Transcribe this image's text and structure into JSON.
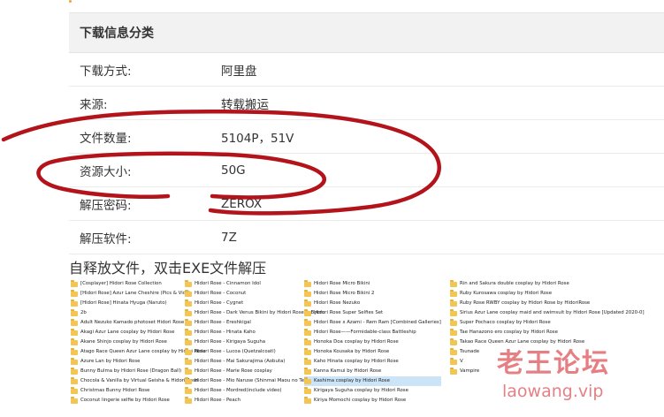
{
  "info": {
    "header": "下载信息分类",
    "rows": [
      {
        "key": "下载方式:",
        "value": "阿里盘"
      },
      {
        "key": "来源:",
        "value": "转载搬运"
      },
      {
        "key": "文件数量:",
        "value": "5104P，51V"
      },
      {
        "key": "资源大小:",
        "value": "50G"
      },
      {
        "key": "解压密码:",
        "value": "ZEROX"
      },
      {
        "key": "解压软件:",
        "value": "7Z"
      }
    ]
  },
  "sfx_note": "自释放文件，双击EXE文件解压",
  "files": {
    "col1": [
      "[Cosplayer] Hidori Rose Collection",
      "[Hidori Rose] Azur Lane Cheshire (Pics & Vids)",
      "[Hidori Rose] Hinata Hyuga (Naruto)",
      "2b",
      "Adult Nezuko Kamado photoset Hidori Rose",
      "Akagi Azur Lane cosplay by Hidori Rose",
      "Akane Shinjo cosplay by Hidori Rose",
      "Atago Race Queen Azur Lane cosplay by Hidori Rose",
      "Azure Lan by Hidori Rose",
      "Bunny Bulma by Hidori Rose (Dragon Ball)",
      "Chocola & Vanilla by Virtual Geisha & Hidori Rose",
      "Christmas Bunny Hidori Rose",
      "Coconut lingerie selfie by Hidori Rose"
    ],
    "col2": [
      "Hidori Rose - Cinnamon Idol",
      "Hidori Rose - Coconut",
      "Hidori Rose - Cygnet",
      "Hidori Rose - Dark Venus Bikini by Hidori Rose & Byoru",
      "Hidori Rose - Ereshkigal",
      "Hidori Rose - Hinata Kaho",
      "Hidori Rose - Kirigaya Suguha",
      "Hidori Rose - Lucoa (Quetzalcoatl)",
      "Hidori Rose - Mai Sakurajima (Aobuta)",
      "Hidori Rose - Marie Rose cosplay",
      "Hidori Rose - Mio Naruse (Shinmai Maou no Testament)",
      "Hidori Rose - Mordred(include video)",
      "Hidori Rose - Peach"
    ],
    "col3": [
      "Hidori Rose Micro Bikini",
      "Hidori Rose Micro Bikini 2",
      "Hidori Rose Nezuko",
      "Hidori Rose Super Selfies Set",
      "Hidori Rose x Azami - Rem Ram [Combined Galleries]",
      "Hidori Rose——Formidable-class Battleship",
      "Honoka Doa cosplay by Hidori Rose",
      "Honoka Kousaka by Hidori Rose",
      "Kaho Hinata cosplay by Hidori Rose",
      "Kanna Kamui by Hidori Rose",
      "Kashima cosplay by Hidori Rose",
      "Kirigaya Suguha cosplay by Hidori Rose",
      "Kiriya Momochi cosplay by Hidori Rose"
    ],
    "col4": [
      "Rin and Sakura double cosplay by Hidori Rose",
      "Ruby Kurosawa cosplay by Hidori Rose",
      "Ruby Rose RWBY cosplay by Hidori Rose by HidoriRose",
      "Sirius Azur Lane cosplay maid and swimsuit by Hidori Rose [Updated 2020-0]",
      "Super Pochaco cosplay by Hidori Rose",
      "Tae Hanazono ero cosplay by Hidori Rose",
      "Takao Race Queen Azur Lane cosplay by Hidori Rose",
      "Tsunade",
      "V",
      "Vampire"
    ],
    "selected": "Kashima cosplay by Hidori Rose"
  },
  "watermark": {
    "cn": "老王论坛",
    "en": "laowang.vip"
  },
  "colors": {
    "header_bg": "#f2f2f2",
    "folder": "#f3c553",
    "ink": "#b3141b",
    "watermark": "#d2171e"
  }
}
